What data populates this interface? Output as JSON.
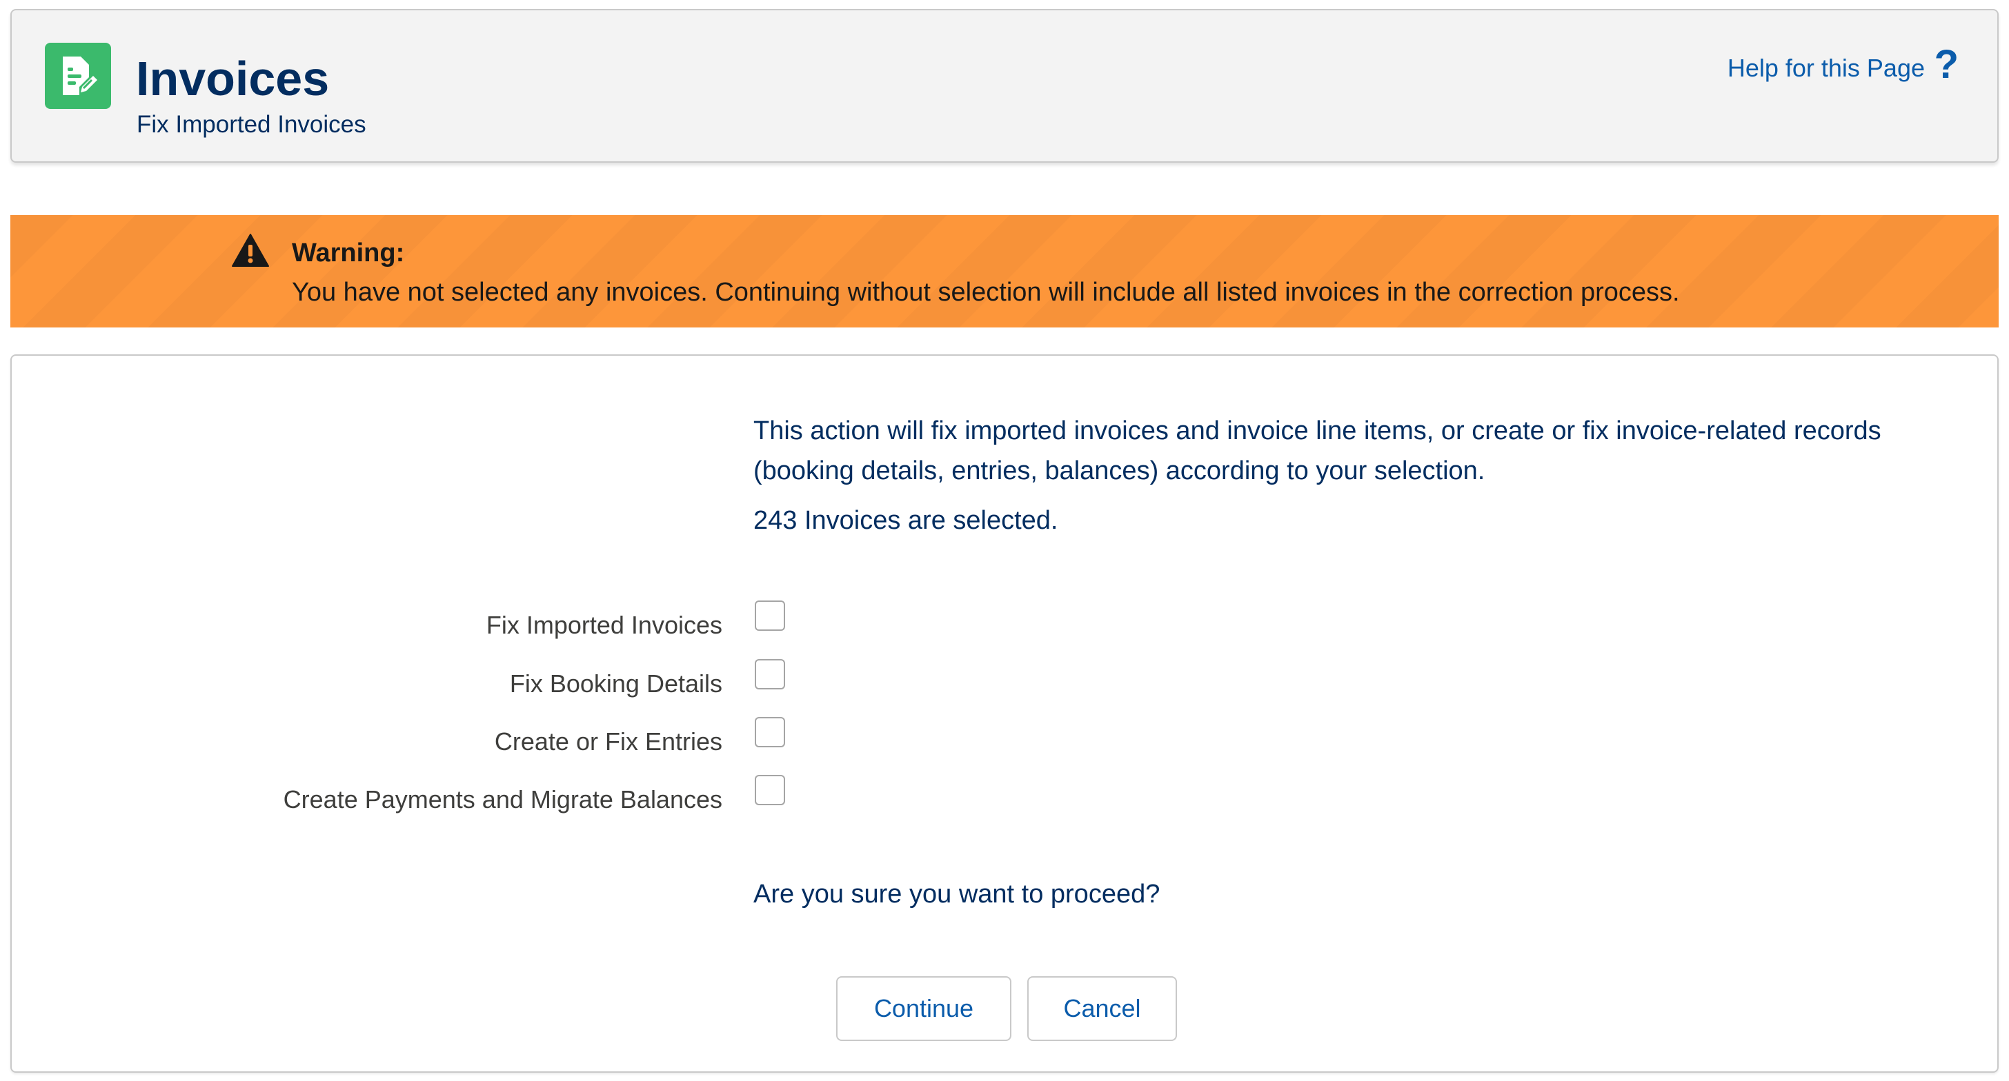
{
  "header": {
    "icon": "invoice-document-icon",
    "title": "Invoices",
    "subtitle": "Fix Imported Invoices",
    "help_link": "Help for this Page",
    "help_icon": "question-mark-icon",
    "help_icon_glyph": "?"
  },
  "warning": {
    "icon": "warning-triangle-icon",
    "background_color": "#fd963a",
    "title": "Warning:",
    "message": "You have not selected any invoices. Continuing without selection will include all listed invoices in the correction process."
  },
  "main": {
    "description": "This action will fix imported invoices and invoice line items, or create or fix invoice-related records (booking details, entries, balances) according to your selection.",
    "selected_count": "243 Invoices are selected.",
    "options": [
      {
        "label": "Fix Imported Invoices",
        "checked": false
      },
      {
        "label": "Fix Booking Details",
        "checked": false
      },
      {
        "label": "Create or Fix Entries",
        "checked": false
      },
      {
        "label": "Create Payments and Migrate Balances",
        "checked": false
      }
    ],
    "confirm_text": "Are you sure you want to proceed?",
    "buttons": {
      "continue": "Continue",
      "cancel": "Cancel"
    }
  },
  "colors": {
    "title_text": "#032d60",
    "link": "#0b5cab",
    "icon_bg": "#3bba6c"
  }
}
